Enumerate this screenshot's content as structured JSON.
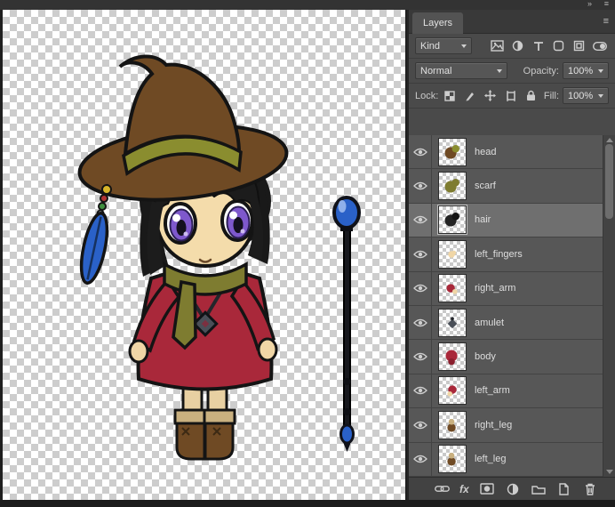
{
  "window": {
    "icons": {
      "collapse_glyph": "»",
      "menu_glyph": "≡"
    }
  },
  "panel": {
    "tab_label": "Layers",
    "tab_menu_glyph": "≡",
    "filter": {
      "kind_label": "Kind",
      "icon_names": [
        "pixel-layer-filter",
        "adjustment-layer-filter",
        "type-layer-filter",
        "shape-layer-filter",
        "smart-object-filter",
        "layer-filtering-toggle"
      ]
    },
    "blend": {
      "mode_value": "Normal",
      "opacity_label": "Opacity:",
      "opacity_value": "100%"
    },
    "lock": {
      "label": "Lock:",
      "icon_names": [
        "lock-transparent-pixels",
        "lock-image-pixels",
        "lock-position",
        "lock-artboard",
        "lock-all"
      ],
      "fill_label": "Fill:",
      "fill_value": "100%"
    },
    "layers": {
      "selected": "hair",
      "items": [
        {
          "name": "head",
          "visible": true,
          "thumb_color": "#6f4a24",
          "thumb_color2": "#8a8d2f"
        },
        {
          "name": "scarf",
          "visible": true,
          "thumb_color": "#7e7c30",
          "thumb_color2": "#7e7c30"
        },
        {
          "name": "hair",
          "visible": true,
          "selected": true,
          "thumb_color": "#232323",
          "thumb_color2": "#161616"
        },
        {
          "name": "left_fingers",
          "visible": true,
          "thumb_color": "#f0d6a6",
          "thumb_color2": "#f0d6a6"
        },
        {
          "name": "right_arm",
          "visible": true,
          "thumb_color": "#a9283a",
          "thumb_color2": "#f0d6a6"
        },
        {
          "name": "amulet",
          "visible": true,
          "thumb_color": "#4a4f58",
          "thumb_color2": "#23262b"
        },
        {
          "name": "body",
          "visible": true,
          "thumb_color": "#a9283a",
          "thumb_color2": "#8a1f2e"
        },
        {
          "name": "left_arm",
          "visible": true,
          "thumb_color": "#a9283a",
          "thumb_color2": "#f0d6a6"
        },
        {
          "name": "right_leg",
          "visible": true,
          "thumb_color": "#6f4a24",
          "thumb_color2": "#c9b07f"
        },
        {
          "name": "left_leg",
          "visible": true,
          "thumb_color": "#6f4a24",
          "thumb_color2": "#c9b07f"
        }
      ]
    },
    "footer": {
      "fx_label": "fx",
      "icon_names": [
        "link-layers",
        "layer-effects",
        "add-layer-mask",
        "adjustment-layer",
        "new-group",
        "new-layer",
        "delete-layer"
      ]
    }
  },
  "artwork": {
    "colors": {
      "hat": "#6f4a24",
      "hat_band": "#8a8d2f",
      "hair": "#1c1c1c",
      "skin": "#f4dcab",
      "eyes": "#7e58cc",
      "dress": "#a9283a",
      "scarf": "#7e7c30",
      "staff_orb": "#2a61c8",
      "boots": "#6f4a24",
      "feather": "#2a61c8"
    }
  }
}
